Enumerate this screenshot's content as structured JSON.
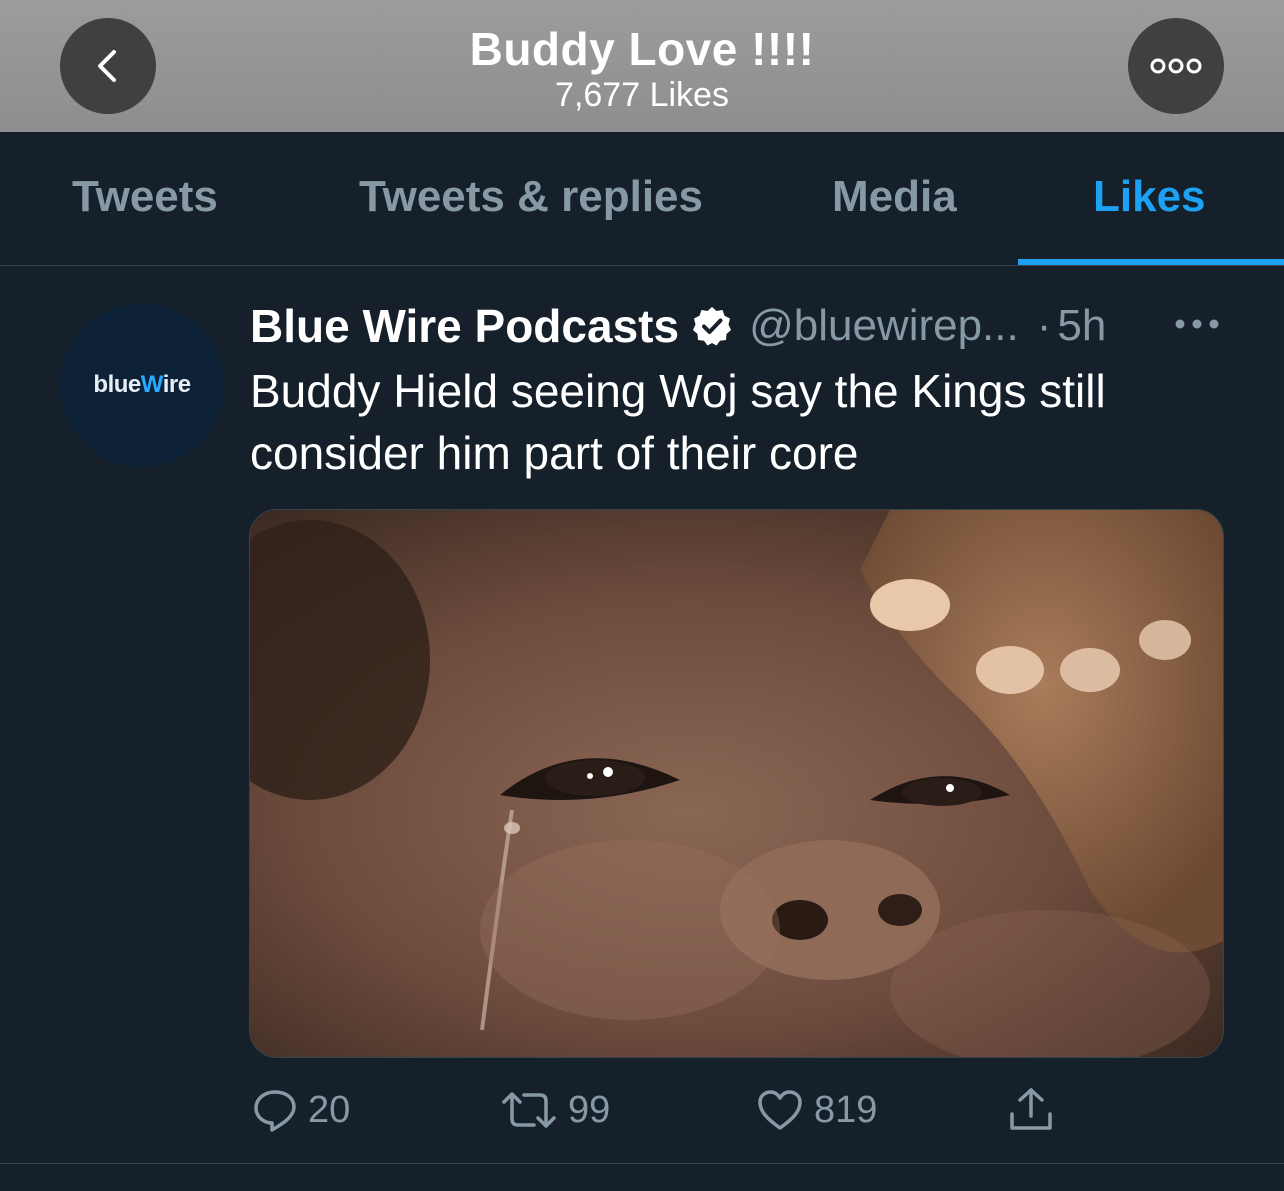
{
  "header": {
    "title": "Buddy Love !!!!",
    "subtitle": "7,677 Likes",
    "back_icon": "chevron-left-icon",
    "more_icon": "more-dots-icon"
  },
  "tabs": [
    {
      "label": "Tweets",
      "active": false
    },
    {
      "label": "Tweets & replies",
      "active": false
    },
    {
      "label": "Media",
      "active": false
    },
    {
      "label": "Likes",
      "active": true
    }
  ],
  "tweet": {
    "avatar_text_prefix": "blue",
    "avatar_text_mark": "W",
    "avatar_text_suffix": "ire",
    "author": "Blue Wire Podcasts",
    "verified": true,
    "handle": "@bluewirep...",
    "separator": "·",
    "time": "5h",
    "text": "Buddy Hield seeing Woj say the Kings still consider him part of their core",
    "media_icon": "crying-baby-photo",
    "actions": {
      "reply_count": "20",
      "retweet_count": "99",
      "like_count": "819"
    }
  },
  "colors": {
    "background": "#15202b",
    "accent": "#1da1f2",
    "muted": "#8899a6",
    "divider": "#38444d"
  }
}
